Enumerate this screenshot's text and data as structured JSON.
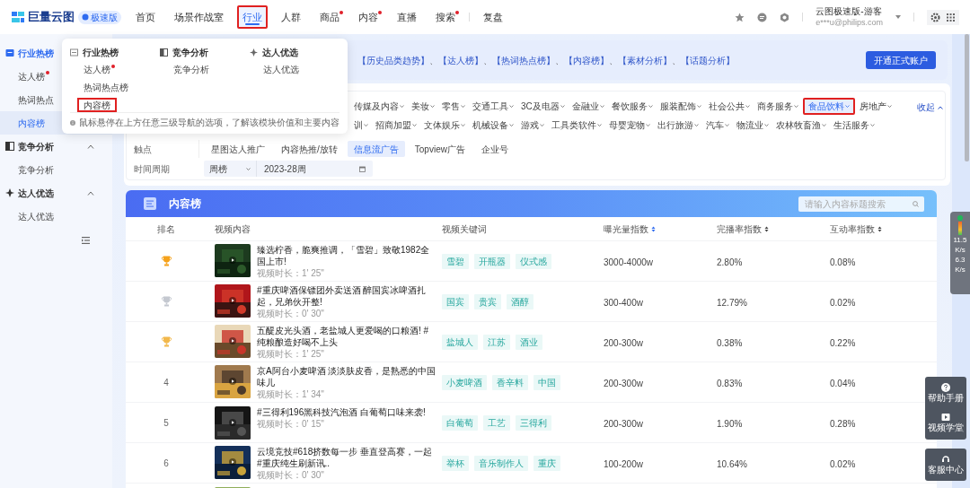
{
  "header": {
    "brand": "巨量云图",
    "badge": "极速版",
    "nav": [
      {
        "label": "首页",
        "selected": false,
        "dot": false,
        "highlighted": false
      },
      {
        "label": "场景作战室",
        "selected": false,
        "dot": false,
        "highlighted": false
      },
      {
        "label": "行业",
        "selected": true,
        "dot": false,
        "highlighted": true
      },
      {
        "label": "人群",
        "selected": false,
        "dot": false,
        "highlighted": false
      },
      {
        "label": "商品",
        "selected": false,
        "dot": true,
        "highlighted": false
      },
      {
        "label": "内容",
        "selected": false,
        "dot": true,
        "highlighted": false
      },
      {
        "label": "直播",
        "selected": false,
        "dot": false,
        "highlighted": false
      },
      {
        "label": "搜索",
        "selected": false,
        "dot": true,
        "highlighted": false
      },
      {
        "label": "复盘",
        "selected": false,
        "dot": false,
        "highlighted": false
      }
    ],
    "user": {
      "name": "云图极速版-游客",
      "email": "e***u@philips.com"
    }
  },
  "sidebar": [
    {
      "label": "行业热榜",
      "expanded": true,
      "children": [
        {
          "label": "达人榜",
          "selected": false,
          "dot": true
        },
        {
          "label": "热词热点",
          "selected": false,
          "dot": false
        },
        {
          "label": "内容榜",
          "selected": true,
          "dot": false
        }
      ]
    },
    {
      "label": "竞争分析",
      "expanded": true,
      "children": [
        {
          "label": "竞争分析",
          "selected": false,
          "dot": false
        }
      ]
    },
    {
      "label": "达人优选",
      "expanded": true,
      "children": [
        {
          "label": "达人优选",
          "selected": false,
          "dot": false
        }
      ]
    }
  ],
  "dropdown": {
    "columns": [
      {
        "title": "行业热榜",
        "items": [
          {
            "label": "达人榜",
            "dot": true,
            "highlighted": false
          },
          {
            "label": "热词热点榜",
            "dot": false,
            "highlighted": false
          },
          {
            "label": "内容榜",
            "dot": false,
            "highlighted": true
          }
        ]
      },
      {
        "title": "竞争分析",
        "items": [
          {
            "label": "竞争分析",
            "dot": false,
            "highlighted": false
          }
        ]
      },
      {
        "title": "达人优选",
        "items": [
          {
            "label": "达人优选",
            "dot": false,
            "highlighted": false
          }
        ]
      }
    ],
    "note": "鼠标悬停在上方任意三级导航的选项，了解该模块价值和主要内容"
  },
  "banner": {
    "links": [
      "【历史品类趋势】",
      "【达人榜】",
      "【热词热点榜】",
      "【内容榜】",
      "【素材分析】",
      "【话题分析】"
    ],
    "separator": "、",
    "button": "开通正式账户"
  },
  "filters": {
    "industry_rows": [
      {
        "items": [
          {
            "label": "传媒及内容",
            "selected": false,
            "highlighted": false
          },
          {
            "label": "美妆",
            "selected": false,
            "highlighted": false
          },
          {
            "label": "零售",
            "selected": false,
            "highlighted": false
          },
          {
            "label": "交通工具",
            "selected": false,
            "highlighted": false
          },
          {
            "label": "3C及电器",
            "selected": false,
            "highlighted": false
          },
          {
            "label": "金融业",
            "selected": false,
            "highlighted": false
          },
          {
            "label": "餐饮服务",
            "selected": false,
            "highlighted": false
          },
          {
            "label": "服装配饰",
            "selected": false,
            "highlighted": false
          },
          {
            "label": "社会公共",
            "selected": false,
            "highlighted": false
          },
          {
            "label": "商务服务",
            "selected": false,
            "highlighted": false
          },
          {
            "label": "食品饮料",
            "selected": true,
            "highlighted": true
          },
          {
            "label": "房地产",
            "selected": false,
            "highlighted": false
          }
        ]
      },
      {
        "items": [
          {
            "label": "训",
            "selected": false,
            "highlighted": false
          },
          {
            "label": "招商加盟",
            "selected": false,
            "highlighted": false
          },
          {
            "label": "文体娱乐",
            "selected": false,
            "highlighted": false
          },
          {
            "label": "机械设备",
            "selected": false,
            "highlighted": false
          },
          {
            "label": "游戏",
            "selected": false,
            "highlighted": false
          },
          {
            "label": "工具类软件",
            "selected": false,
            "highlighted": false
          },
          {
            "label": "母婴宠物",
            "selected": false,
            "highlighted": false
          },
          {
            "label": "出行旅游",
            "selected": false,
            "highlighted": false
          },
          {
            "label": "汽车",
            "selected": false,
            "highlighted": false
          },
          {
            "label": "物流业",
            "selected": false,
            "highlighted": false
          },
          {
            "label": "农林牧畜渔",
            "selected": false,
            "highlighted": false
          },
          {
            "label": "生活服务",
            "selected": false,
            "highlighted": false
          }
        ]
      }
    ],
    "collapse": "收起",
    "touchpoint": {
      "label": "触点",
      "options": [
        {
          "label": "星图达人推广",
          "selected": false
        },
        {
          "label": "内容热推/放转",
          "selected": false
        },
        {
          "label": "信息流广告",
          "selected": true
        },
        {
          "label": "Topview广告",
          "selected": false
        },
        {
          "label": "企业号",
          "selected": false
        }
      ]
    },
    "period": {
      "label": "时间周期",
      "type": "周榜",
      "value": "2023-28周"
    }
  },
  "table": {
    "title": "内容榜",
    "search_placeholder": "请输入内容标题搜索",
    "columns": [
      {
        "label": "排名",
        "sortable": false
      },
      {
        "label": "视频内容",
        "sortable": false
      },
      {
        "label": "视频关键词",
        "sortable": false
      },
      {
        "label": "曝光量指数",
        "sortable": true
      },
      {
        "label": "完播率指数",
        "sortable": true
      },
      {
        "label": "互动率指数",
        "sortable": true
      }
    ],
    "rows": [
      {
        "kind": "trophy",
        "color": "#f5a21b",
        "title": "臻选柠香，脆爽推调，「雪碧」致敬1982全国上市!",
        "duration": "视频时长：1' 25\"",
        "tags": [
          "雪碧",
          "开瓶器",
          "仪式感"
        ],
        "exposure": "3000-4000w",
        "completion": "2.80%",
        "interaction": "0.08%"
      },
      {
        "kind": "trophy",
        "color": "#c4c8d0",
        "title": "#重庆啤酒保镖团外卖送酒 醉国宾冰啤酒扎起，兄弟伙开整!",
        "duration": "视频时长：0' 30\"",
        "tags": [
          "国宾",
          "贵宾",
          "酒醇"
        ],
        "exposure": "300-400w",
        "completion": "12.79%",
        "interaction": "0.02%"
      },
      {
        "kind": "trophy",
        "color": "#f2b84b",
        "title": "五醍皮光头酒，老盐城人更爱喝的口粮酒! #纯粮酿造好喝不上头",
        "duration": "视频时长：1' 25\"",
        "tags": [
          "盐城人",
          "江苏",
          "酒业"
        ],
        "exposure": "200-300w",
        "completion": "0.38%",
        "interaction": "0.22%"
      },
      {
        "kind": "number",
        "rank": "4",
        "title": "京A阿台小麦啤酒 淡淡肤皮香，是熟悉的中国味儿",
        "duration": "视频时长：1' 34\"",
        "tags": [
          "小麦啤酒",
          "香辛料",
          "中国"
        ],
        "exposure": "200-300w",
        "completion": "0.83%",
        "interaction": "0.04%"
      },
      {
        "kind": "number",
        "rank": "5",
        "title": "#三得利196黑科技汽泡酒 白葡萄口味来袭!",
        "duration": "视频时长：0' 15\"",
        "tags": [
          "白葡萄",
          "工艺",
          "三得利"
        ],
        "exposure": "200-300w",
        "completion": "1.90%",
        "interaction": "0.28%"
      },
      {
        "kind": "number",
        "rank": "6",
        "title": "云境竞技#618挤数每一步 垂直登高赛，一起#重庆纯生刷新讯..",
        "duration": "视频时长：0' 30\"",
        "tags": [
          "举杯",
          "音乐制作人",
          "重庆"
        ],
        "exposure": "100-200w",
        "completion": "10.64%",
        "interaction": "0.02%"
      },
      {
        "kind": "partial"
      }
    ]
  },
  "net_widget": {
    "up": "11.5",
    "up_unit": "K/s",
    "down": "6.3",
    "down_unit": "K/s"
  },
  "float_buttons": [
    "帮助手册",
    "视频学堂",
    "客服中心"
  ]
}
